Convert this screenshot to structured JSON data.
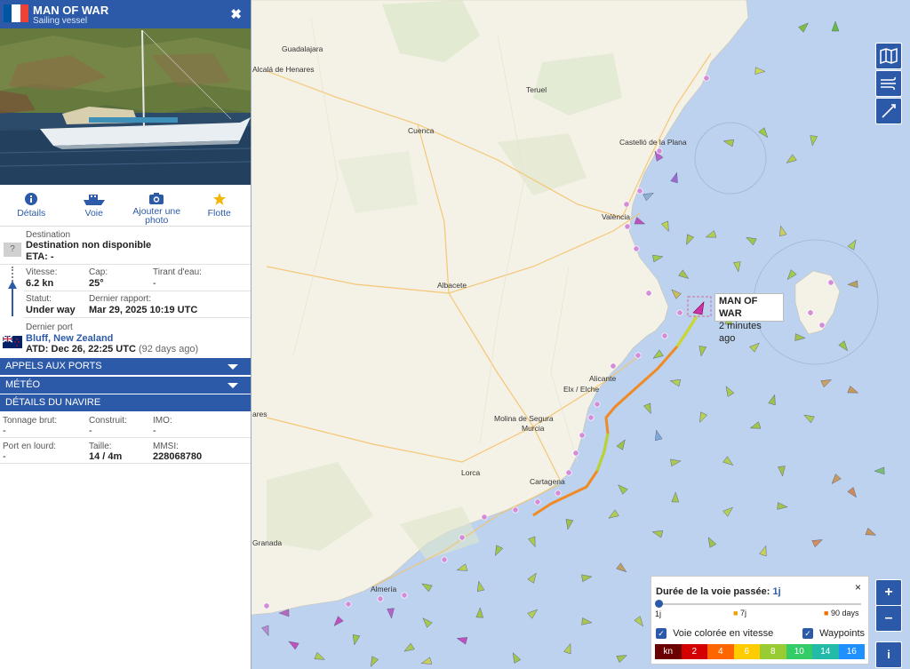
{
  "vessel": {
    "name": "MAN OF WAR",
    "type": "Sailing vessel",
    "flag_colors": [
      "#0055A4",
      "#FFFFFF",
      "#EF4135"
    ],
    "close_icon": "close-icon"
  },
  "tabs": [
    {
      "label": "Détails",
      "icon": "info-icon"
    },
    {
      "label": "Voie",
      "icon": "ship-icon"
    },
    {
      "label": "Ajouter une photo",
      "icon": "camera-icon"
    },
    {
      "label": "Flotte",
      "icon": "star-icon"
    }
  ],
  "destination": {
    "label": "Destination",
    "value": "Destination non disponible",
    "eta": "ETA: -",
    "badge": "?"
  },
  "nav": {
    "speed_label": "Vitesse:",
    "speed": "6.2 kn",
    "course_label": "Cap:",
    "course": "25°",
    "draught_label": "Tirant d'eau:",
    "draught": "-",
    "status_label": "Statut:",
    "status": "Under way",
    "report_label": "Dernier rapport:",
    "report": "Mar 29, 2025 10:19 UTC"
  },
  "last_port": {
    "label": "Dernier port",
    "name": "Bluff, New Zealand",
    "atd": "ATD: Dec 26, 22:25 UTC",
    "ago": "(92 days ago)"
  },
  "sections": [
    "APPELS AUX PORTS",
    "MÉTÉO",
    "DÉTAILS DU NAVIRE"
  ],
  "details": {
    "gt_label": "Tonnage brut:",
    "gt": "-",
    "built_label": "Construit:",
    "built": "-",
    "imo_label": "IMO:",
    "imo": "-",
    "dwt_label": "Port en lourd:",
    "dwt": "-",
    "size_label": "Taille:",
    "size": "14 / 4m",
    "mmsi_label": "MMSI:",
    "mmsi": "228068780"
  },
  "map": {
    "cities": [
      "Guadalajara",
      "Alcalá de Henares",
      "Teruel",
      "Cuenca",
      "Castelló de la Plana",
      "València",
      "Albacete",
      "Alicante",
      "Elx / Elche",
      "Molina de Segura",
      "Murcia",
      "Lorca",
      "Cartagena",
      "Almería",
      "Granada",
      "ares"
    ],
    "callout_name": "MAN OF WAR",
    "callout_time": "2 minutes ago",
    "side_buttons": [
      "map-layers-icon",
      "wind-icon",
      "compass-icon"
    ],
    "zoom_in": "+",
    "zoom_out": "–",
    "info": "i"
  },
  "legend": {
    "title": "Durée de la voie passée:",
    "value": "1j",
    "marks": [
      "1j",
      "7j",
      "90 days"
    ],
    "speed_colored": "Voie colorée en vitesse",
    "waypoints": "Waypoints",
    "close": "×",
    "scale_unit": "kn",
    "scale": [
      "2",
      "4",
      "6",
      "8",
      "10",
      "14",
      "16"
    ],
    "scale_colors": [
      "#6a0000",
      "#d40000",
      "#ff6600",
      "#ffcc00",
      "#99cc33",
      "#33cc66",
      "#22bbaa",
      "#1e90ff"
    ]
  }
}
